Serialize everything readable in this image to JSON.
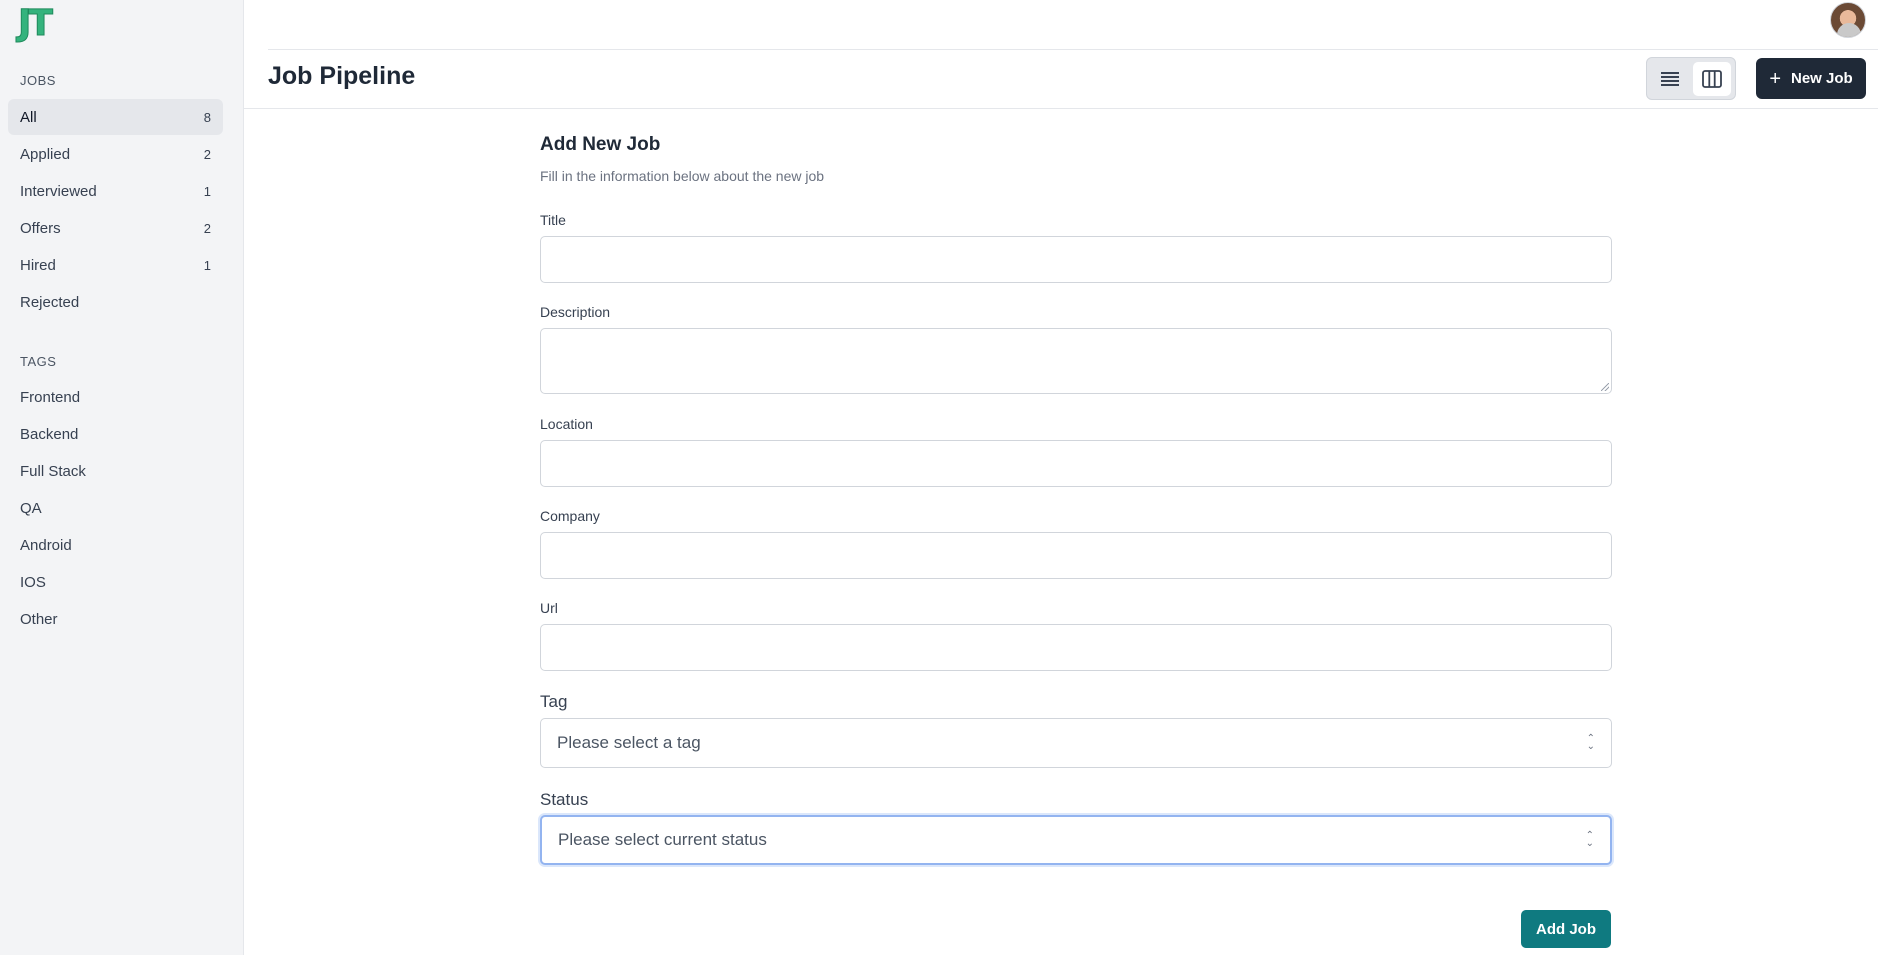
{
  "app": {
    "logo": "JT"
  },
  "sidebar": {
    "jobs_label": "JOBS",
    "jobs": [
      {
        "label": "All",
        "count": "8"
      },
      {
        "label": "Applied",
        "count": "2"
      },
      {
        "label": "Interviewed",
        "count": "1"
      },
      {
        "label": "Offers",
        "count": "2"
      },
      {
        "label": "Hired",
        "count": "1"
      },
      {
        "label": "Rejected",
        "count": ""
      }
    ],
    "tags_label": "TAGS",
    "tags": [
      {
        "label": "Frontend"
      },
      {
        "label": "Backend"
      },
      {
        "label": "Full Stack"
      },
      {
        "label": "QA"
      },
      {
        "label": "Android"
      },
      {
        "label": "IOS"
      },
      {
        "label": "Other"
      }
    ]
  },
  "header": {
    "title": "Job Pipeline",
    "new_job_label": "New Job",
    "view_modes": [
      "list-view-icon",
      "board-view-icon"
    ],
    "selected_view": "board"
  },
  "form": {
    "title": "Add New Job",
    "subtitle": "Fill in the information below about the new job",
    "fields": {
      "title_label": "Title",
      "title_value": "",
      "description_label": "Description",
      "description_value": "",
      "location_label": "Location",
      "location_value": "",
      "company_label": "Company",
      "company_value": "",
      "url_label": "Url",
      "url_value": "",
      "tag_label": "Tag",
      "tag_placeholder": "Please select a tag",
      "status_label": "Status",
      "status_placeholder": "Please select current status"
    },
    "submit_label": "Add Job"
  },
  "colors": {
    "logo": "#34b37d",
    "primary_dark": "#1f2937",
    "submit": "#0f7a80",
    "focus_ring": "#93b4f0"
  }
}
